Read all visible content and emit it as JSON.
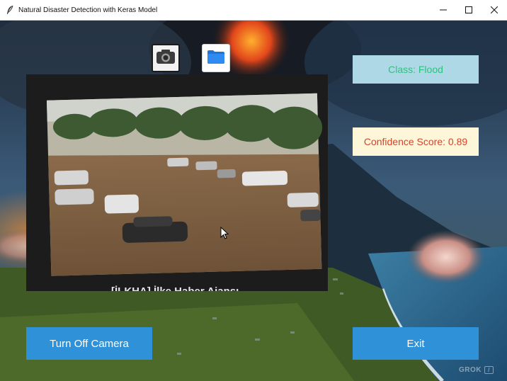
{
  "window": {
    "title": "Natural Disaster Detection with Keras Model",
    "app_icon": "feather-icon",
    "controls": [
      "minimize-icon",
      "maximize-icon",
      "close-icon"
    ]
  },
  "toolbar": {
    "camera_icon": "camera-icon",
    "folder_icon": "folder-icon"
  },
  "video": {
    "caption": "[İLKHA] İlke Haber Ajansı"
  },
  "results": {
    "class_text": "Class: Flood",
    "confidence_text": "Confidence Score: 0.89"
  },
  "buttons": {
    "turn_off_camera": "Turn Off Camera",
    "exit": "Exit"
  },
  "watermark": {
    "text": "GROK"
  },
  "colors": {
    "button_bg": "#2f91d8",
    "class_box_bg": "#aed8e6",
    "class_text": "#2ec27e",
    "confidence_box_bg": "#fdf6d8",
    "confidence_text": "#d2452c"
  }
}
